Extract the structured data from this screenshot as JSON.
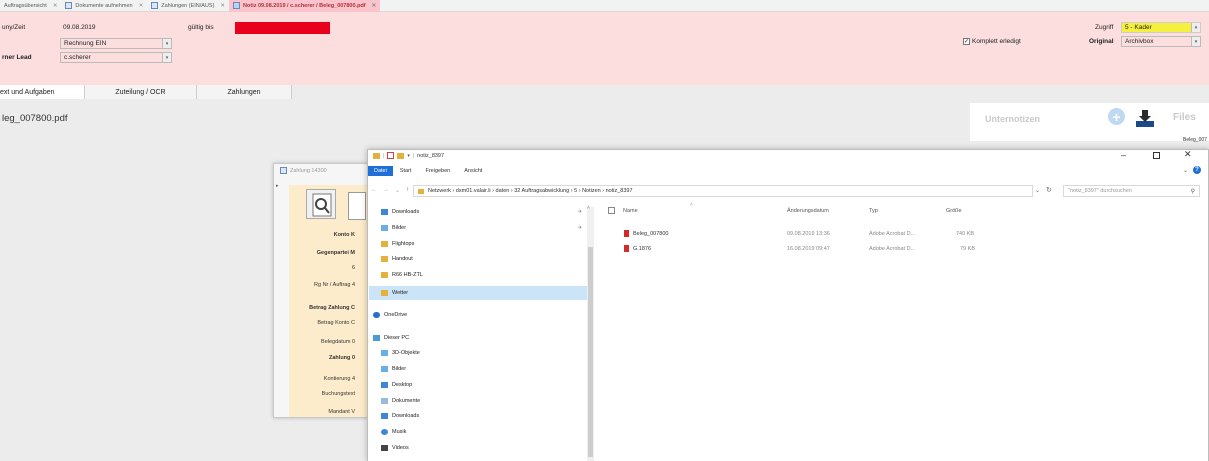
{
  "tabs": [
    {
      "label": "Auftragsübersicht",
      "active": false
    },
    {
      "label": "Dokumente aufnehmen",
      "active": false
    },
    {
      "label": "Zahlungen (EIN/AUS)",
      "active": false
    },
    {
      "label": "Notiz 09.08.2019 / c.scherer / Beleg_007800.pdf",
      "active": true
    }
  ],
  "header": {
    "row1_label": "uny/Zeit",
    "date": "09.08.2019",
    "gueltig_label": "gültig bis",
    "type_value": "Rechnung EIN",
    "lead_label": "rner Lead",
    "lead_value": "c.scherer",
    "komplett_label": "Komplett erledigt",
    "zugriff_label": "Zugriff",
    "zugriff_value": "5 - Kader",
    "original_label": "Original",
    "original_value": "Archivbox"
  },
  "subtabs": [
    "ext und Aufgaben",
    "Zuteilung / OCR",
    "Zahlungen"
  ],
  "pdf_title": "leg_007800.pdf",
  "notes_label": "Unternotizen",
  "files_label": "Files",
  "files_item": "Beleg_007",
  "zahlung": {
    "title": "Zahlung 14300",
    "labels": [
      {
        "text": "Konto",
        "bold": true,
        "suffix": "K"
      },
      {
        "text": "Gegenpartei",
        "bold": true,
        "suffix": "M"
      },
      {
        "text": "",
        "bold": false,
        "suffix": "6"
      },
      {
        "text": "Rg Nr / Auftrag",
        "bold": false,
        "suffix": "4"
      },
      {
        "text": "Betrag Zahlung",
        "bold": true,
        "suffix": "C"
      },
      {
        "text": "Betrag Konto",
        "bold": false,
        "suffix": "C"
      },
      {
        "text": "Belegdatum",
        "bold": false,
        "suffix": "0"
      },
      {
        "text": "Zahlung",
        "bold": true,
        "suffix": "0"
      },
      {
        "text": "Kontierung",
        "bold": false,
        "suffix": "4"
      },
      {
        "text": "Buchungstext",
        "bold": false,
        "suffix": ""
      },
      {
        "text": "Mandant",
        "bold": false,
        "suffix": "V"
      }
    ]
  },
  "explorer": {
    "title": "notiz_8397",
    "ribbon": [
      "Datei",
      "Start",
      "Freigeben",
      "Ansicht"
    ],
    "breadcrumb": "Netzwerk  ›  dsm01.valair.li  ›  daten  ›  32 Auftragsabwicklung  ›  5  ›  Notizen  ›  notiz_8397",
    "search_placeholder": "\"notiz_8397\" durchsuchen",
    "nav": [
      {
        "label": "Downloads",
        "icon": "download-folder-icon"
      },
      {
        "label": "Bilder",
        "icon": "folder-icon"
      },
      {
        "label": "Flightops",
        "icon": "folder-icon"
      },
      {
        "label": "Handout",
        "icon": "folder-icon"
      },
      {
        "label": "R66 HB-ZTL",
        "icon": "folder-icon"
      },
      {
        "label": "Wetter",
        "icon": "folder-icon"
      },
      {
        "label": "OneDrive",
        "icon": "onedrive-icon"
      },
      {
        "label": "Dieser PC",
        "icon": "pc-icon"
      },
      {
        "label": "3D-Objekte",
        "icon": "folder-icon"
      },
      {
        "label": "Bilder",
        "icon": "folder-icon"
      },
      {
        "label": "Desktop",
        "icon": "folder-icon"
      },
      {
        "label": "Dokumente",
        "icon": "folder-icon"
      },
      {
        "label": "Downloads",
        "icon": "download-folder-icon"
      },
      {
        "label": "Musik",
        "icon": "music-icon"
      },
      {
        "label": "Videos",
        "icon": "video-icon"
      }
    ],
    "columns": [
      "Name",
      "Änderungsdatum",
      "Typ",
      "Größe"
    ],
    "files": [
      {
        "name": "Beleg_007800",
        "date": "09.08.2019 13:36",
        "type": "Adobe Acrobat D...",
        "size": "740 KB"
      },
      {
        "name": "G.1876",
        "date": "16.08.2019 09:47",
        "type": "Adobe Acrobat D...",
        "size": "79 KB"
      }
    ],
    "colors": {
      "accent": "#1e6fd8",
      "selected": "#cce4f7"
    }
  }
}
